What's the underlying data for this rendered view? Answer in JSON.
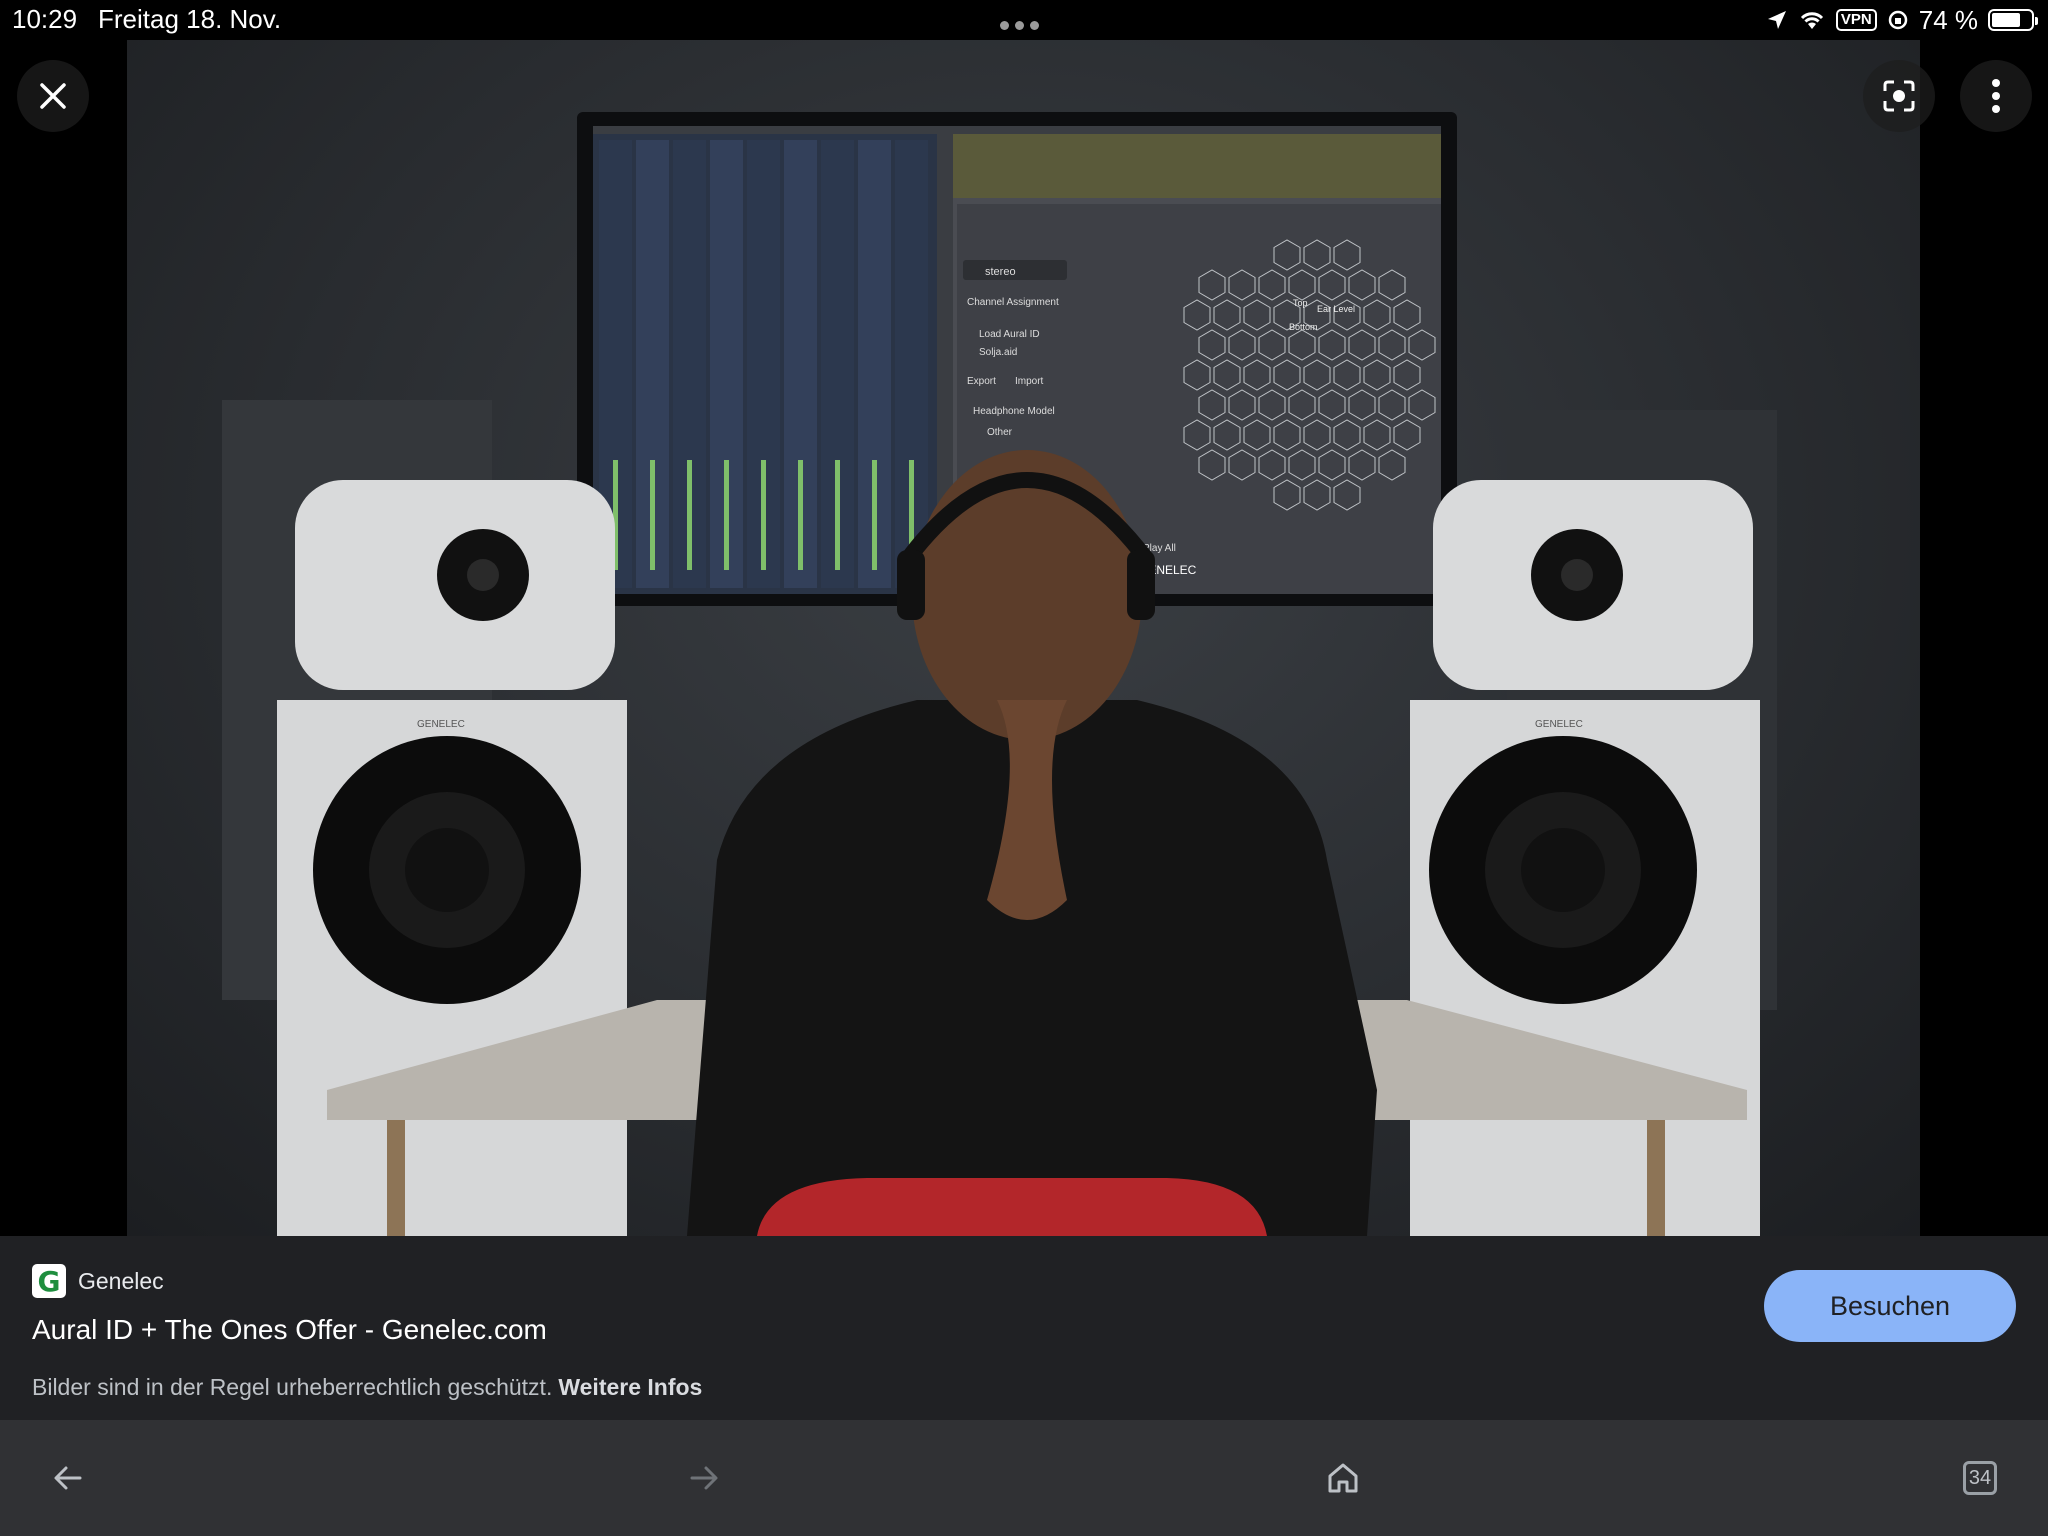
{
  "status_bar": {
    "time": "10:29",
    "date": "Freitag 18. Nov.",
    "vpn_label": "VPN",
    "battery_text": "74 %",
    "battery_level": 0.74
  },
  "viewer": {
    "close_icon": "close-icon",
    "lens_icon": "lens-search-icon",
    "menu_icon": "more-vertical-icon",
    "image_text": {
      "left_speaker_brand": "GENELEC",
      "right_speaker_brand": "GENELEC",
      "app_stereo": "stereo",
      "app_channel_assignment": "Channel Assignment",
      "app_load_aural_id": "Load Aural ID",
      "app_file": "Solja.aid",
      "app_export": "Export",
      "app_import": "Import",
      "app_headphone_model": "Headphone Model",
      "app_other": "Other",
      "app_play_all": "Play All",
      "app_brand": "GENELEC",
      "app_top": "Top",
      "app_ear_level": "Ear Level",
      "app_bottom": "Bottom"
    }
  },
  "info": {
    "source_logo_letter": "G",
    "source_name": "Genelec",
    "title": "Aural ID + The Ones Offer - Genelec.com",
    "visit_label": "Besuchen",
    "copyright_text": "Bilder sind in der Regel urheberrechtlich geschützt.",
    "more_info_link": "Weitere Infos",
    "accent_color": "#8ab4f8"
  },
  "toolbar": {
    "back_icon": "arrow-left-icon",
    "forward_icon": "arrow-right-icon",
    "home_icon": "home-icon",
    "tab_count": "34"
  }
}
